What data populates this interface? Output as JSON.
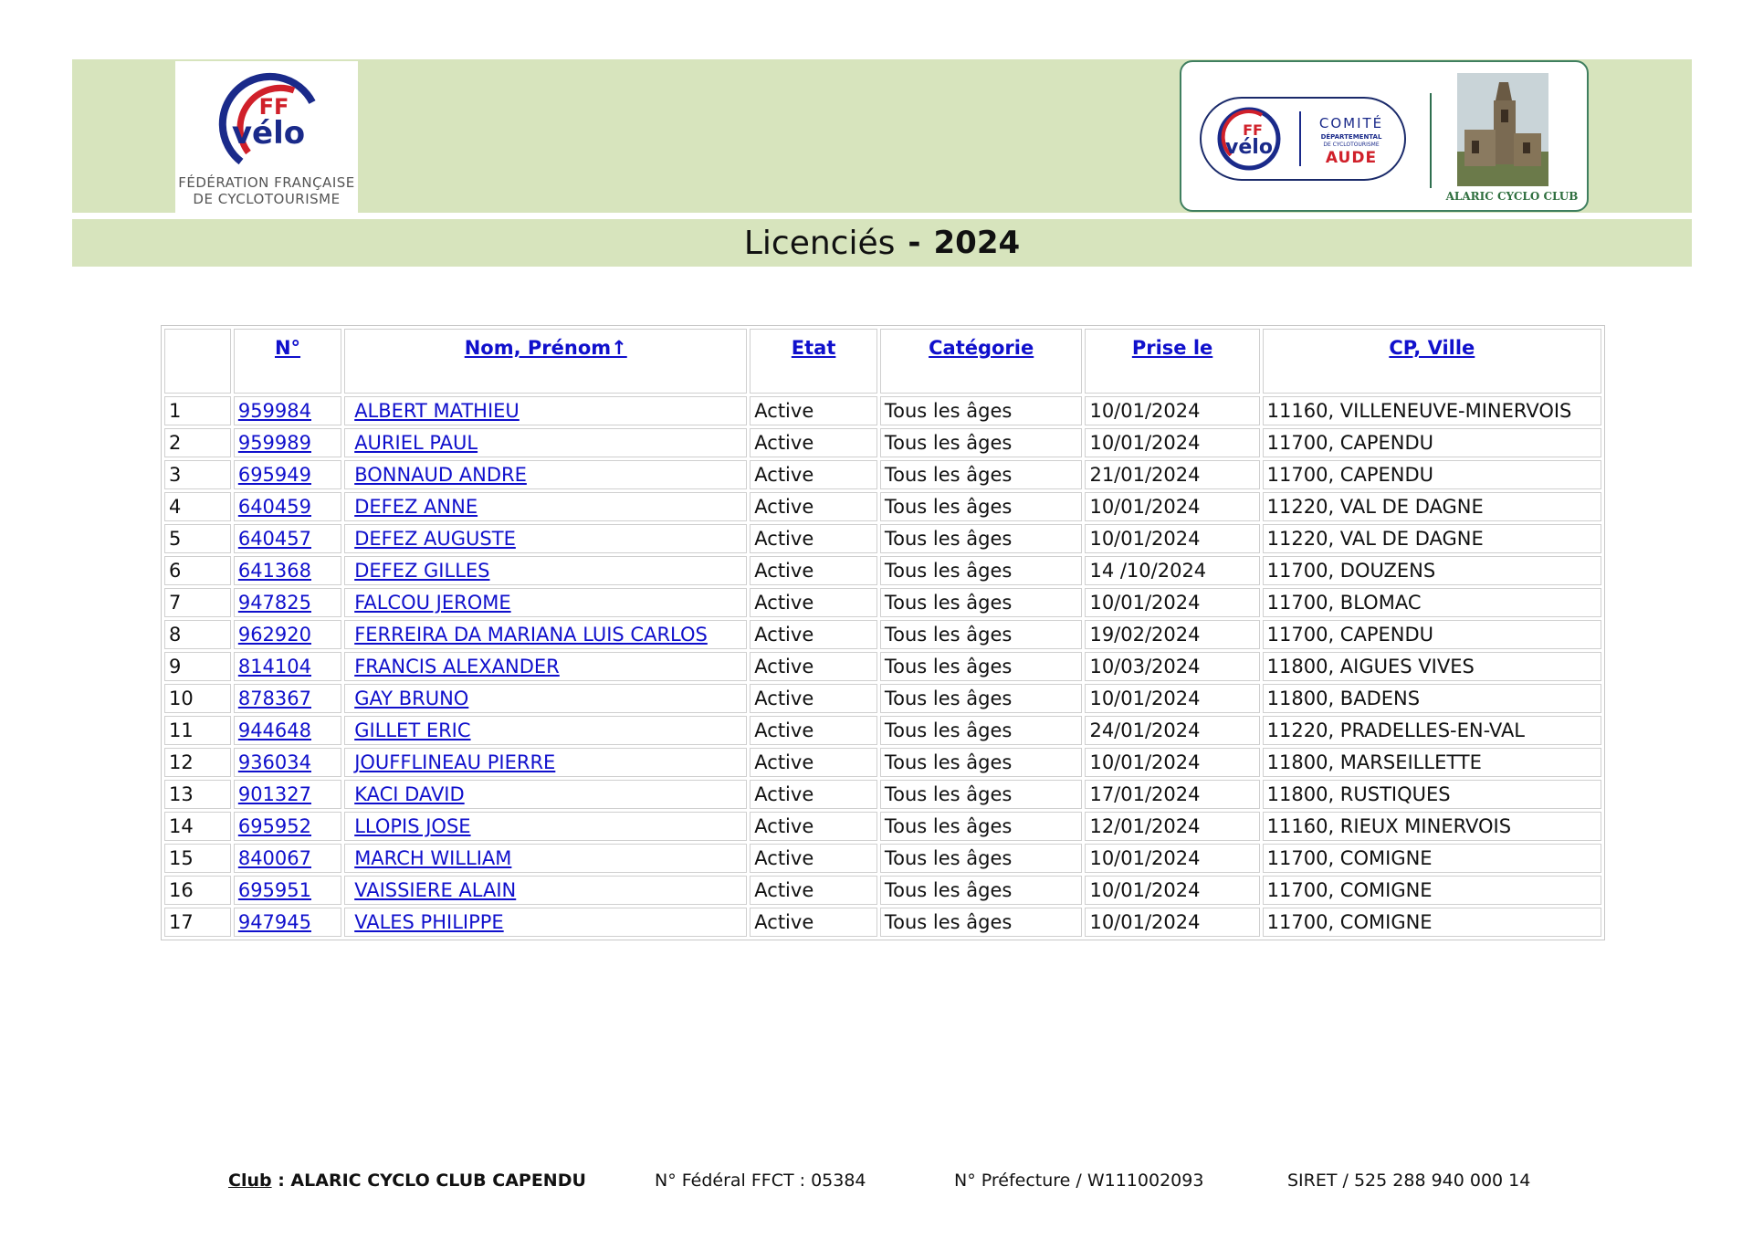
{
  "header": {
    "ffvelo_logo": {
      "ff": "FF",
      "velo": "vélo",
      "caption_line1": "FÉDÉRATION FRANÇAISE",
      "caption_line2": "DE CYCLOTOURISME"
    },
    "comite_logo": {
      "ff": "FF",
      "velo": "vélo",
      "comite": "COMITÉ",
      "departemental": "DÉPARTEMENTAL",
      "de_cyclo": "DE CYCLOTOURISME",
      "aude": "AUDE"
    },
    "club_logo_caption": "ALARIC CYCLO CLUB"
  },
  "title": {
    "main": "Licenciés",
    "separator": "-",
    "year": "2024"
  },
  "table": {
    "columns": [
      "",
      "N°",
      "Nom, Prénom↑",
      "Etat",
      "Catégorie",
      "Prise le",
      "CP, Ville"
    ],
    "rows": [
      [
        "1",
        "959984",
        "ALBERT MATHIEU",
        "Active",
        "Tous les âges",
        "10/01/2024",
        "11160, VILLENEUVE-MINERVOIS"
      ],
      [
        "2",
        "959989",
        "AURIEL PAUL",
        "Active",
        "Tous les âges",
        "10/01/2024",
        "11700, CAPENDU"
      ],
      [
        "3",
        "695949",
        "BONNAUD ANDRE",
        "Active",
        "Tous les âges",
        "21/01/2024",
        "11700, CAPENDU"
      ],
      [
        "4",
        "640459",
        "DEFEZ ANNE",
        "Active",
        "Tous les âges",
        "10/01/2024",
        "11220, VAL DE DAGNE"
      ],
      [
        "5",
        "640457",
        "DEFEZ AUGUSTE",
        "Active",
        "Tous les âges",
        "10/01/2024",
        "11220, VAL DE DAGNE"
      ],
      [
        "6",
        "641368",
        "DEFEZ GILLES",
        "Active",
        "Tous les âges",
        "14 /10/2024",
        "11700, DOUZENS"
      ],
      [
        "7",
        "947825",
        "FALCOU JEROME",
        "Active",
        "Tous les âges",
        "10/01/2024",
        "11700, BLOMAC"
      ],
      [
        "8",
        "962920",
        "FERREIRA DA MARIANA LUIS CARLOS",
        "Active",
        "Tous les âges",
        "19/02/2024",
        "11700, CAPENDU"
      ],
      [
        "9",
        "814104",
        "FRANCIS ALEXANDER",
        "Active",
        "Tous les âges",
        "10/03/2024",
        "11800, AIGUES VIVES"
      ],
      [
        "10",
        "878367",
        "GAY BRUNO",
        "Active",
        "Tous les âges",
        "10/01/2024",
        "11800, BADENS"
      ],
      [
        "11",
        "944648",
        "GILLET ERIC",
        "Active",
        "Tous les âges",
        "24/01/2024",
        "11220, PRADELLES-EN-VAL"
      ],
      [
        "12",
        "936034",
        "JOUFFLINEAU PIERRE",
        "Active",
        "Tous les âges",
        "10/01/2024",
        "11800, MARSEILLETTE"
      ],
      [
        "13",
        "901327",
        "KACI DAVID",
        "Active",
        "Tous les âges",
        "17/01/2024",
        "11800, RUSTIQUES"
      ],
      [
        "14",
        "695952",
        "LLOPIS JOSE",
        "Active",
        "Tous les âges",
        "12/01/2024",
        "11160, RIEUX MINERVOIS"
      ],
      [
        "15",
        "840067",
        "MARCH WILLIAM",
        "Active",
        "Tous les âges",
        "10/01/2024",
        "11700, COMIGNE"
      ],
      [
        "16",
        "695951",
        "VAISSIERE ALAIN",
        "Active",
        "Tous les âges",
        "10/01/2024",
        "11700, COMIGNE"
      ],
      [
        "17",
        "947945",
        "VALES PHILIPPE",
        "Active",
        "Tous les âges",
        "10/01/2024",
        "11700, COMIGNE"
      ]
    ]
  },
  "footer": {
    "club_label": "Club",
    "club_value": " : ALARIC CYCLO CLUB CAPENDU",
    "federal": "N° Fédéral FFCT : 05384",
    "prefecture": "N° Préfecture / W111002093",
    "siret": "SIRET / 525 288 940 000 14"
  },
  "colors": {
    "band": "#d7e4bd",
    "link": "#1010cc",
    "ff_red": "#d0202a",
    "ff_blue": "#1a2a8a"
  }
}
